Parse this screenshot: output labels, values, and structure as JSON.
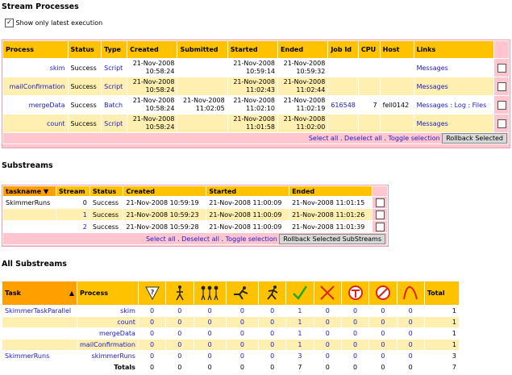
{
  "sp_title": "Stream Processes",
  "latest_label": "Show only latest execution",
  "sp_headers": [
    "Process",
    "Status",
    "Type",
    "Created",
    "Submitted",
    "Started",
    "Ended",
    "Job Id",
    "CPU",
    "Host",
    "Links"
  ],
  "sp_rows": [
    {
      "process": "skim",
      "status": "Success",
      "type": "Script",
      "created": "21-Nov-2008 10:58:24",
      "submitted": "",
      "started": "21-Nov-2008 10:59:14",
      "ended": "21-Nov-2008 10:59:32",
      "jobid": "",
      "cpu": "",
      "host": "",
      "links": "Messages"
    },
    {
      "process": "mailConfirmation",
      "status": "Success",
      "type": "Script",
      "created": "21-Nov-2008 10:58:24",
      "submitted": "",
      "started": "21-Nov-2008 11:02:43",
      "ended": "21-Nov-2008 11:02:44",
      "jobid": "",
      "cpu": "",
      "host": "",
      "links": "Messages"
    },
    {
      "process": "mergeData",
      "status": "Success",
      "type": "Batch",
      "created": "21-Nov-2008 10:58:24",
      "submitted": "21-Nov-2008 11:02:05",
      "started": "21-Nov-2008 11:02:10",
      "ended": "21-Nov-2008 11:02:19",
      "jobid": "616548",
      "cpu": "7",
      "host": "fell0142",
      "links": "Messages : Log : Files"
    },
    {
      "process": "count",
      "status": "Success",
      "type": "Script",
      "created": "21-Nov-2008 10:58:24",
      "submitted": "",
      "started": "21-Nov-2008 11:01:58",
      "ended": "21-Nov-2008 11:02:00",
      "jobid": "",
      "cpu": "",
      "host": "",
      "links": "Messages"
    }
  ],
  "sp_select_all": "Select all",
  "sp_deselect_all": "Deselect all",
  "sp_toggle": "Toggle selection",
  "sp_rollback": "Rollback Selected",
  "sub_title": "Substreams",
  "sub_headers": [
    "taskname",
    "Stream",
    "Status",
    "Created",
    "Started",
    "Ended"
  ],
  "sub_rows": [
    {
      "task": "SkimmerRuns",
      "stream": "0",
      "status": "Success",
      "created": "21-Nov-2008 10:59:19",
      "started": "21-Nov-2008 11:00:09",
      "ended": "21-Nov-2008 11:01:15"
    },
    {
      "task": "",
      "stream": "1",
      "status": "Success",
      "created": "21-Nov-2008 10:59:23",
      "started": "21-Nov-2008 11:00:09",
      "ended": "21-Nov-2008 11:01:26"
    },
    {
      "task": "",
      "stream": "2",
      "status": "Success",
      "created": "21-Nov-2008 10:59:28",
      "started": "21-Nov-2008 11:00:09",
      "ended": "21-Nov-2008 11:01:39"
    }
  ],
  "sub_select_all": "Select all",
  "sub_deselect_all": "Deselect all",
  "sub_toggle": "Toggle selection",
  "sub_rollback": "Rollback Selected SubStreams",
  "all_title": "All Substreams",
  "all_headers": {
    "task": "Task",
    "process": "Process",
    "total": "Total"
  },
  "status_icons": [
    "waiting-icon",
    "walking-icon",
    "group-icon",
    "running-fast-icon",
    "running-icon",
    "check-icon",
    "x-icon",
    "stop-icon",
    "no-entry-icon",
    "retry-arc-icon"
  ],
  "all_rows": [
    {
      "task": "SkimmerTaskParallel",
      "process": "skim",
      "counts": [
        "0",
        "0",
        "0",
        "0",
        "0",
        "1",
        "0",
        "0",
        "0",
        "0"
      ],
      "total": "1",
      "style": "odd"
    },
    {
      "task": "",
      "process": "count",
      "counts": [
        "0",
        "0",
        "0",
        "0",
        "0",
        "1",
        "0",
        "0",
        "0",
        "0"
      ],
      "total": "1",
      "style": "even"
    },
    {
      "task": "",
      "process": "mergeData",
      "counts": [
        "0",
        "0",
        "0",
        "0",
        "0",
        "1",
        "0",
        "0",
        "0",
        "0"
      ],
      "total": "1",
      "style": "odd"
    },
    {
      "task": "",
      "process": "mailConfirmation",
      "counts": [
        "0",
        "0",
        "0",
        "0",
        "0",
        "1",
        "0",
        "0",
        "0",
        "0"
      ],
      "total": "1",
      "style": "even"
    },
    {
      "task": "SkimmerRuns",
      "process": "skimmerRuns",
      "counts": [
        "0",
        "0",
        "0",
        "0",
        "0",
        "3",
        "0",
        "0",
        "0",
        "0"
      ],
      "total": "3",
      "style": "odd"
    }
  ],
  "totals_label": "Totals",
  "totals_counts": [
    "0",
    "0",
    "0",
    "0",
    "0",
    "7",
    "0",
    "0",
    "0",
    "0"
  ],
  "totals_total": "7",
  "colors": {
    "header": "#ffc200",
    "band": "#ffefb0",
    "footer": "#ffc6d0",
    "link": "#1a1acc"
  }
}
